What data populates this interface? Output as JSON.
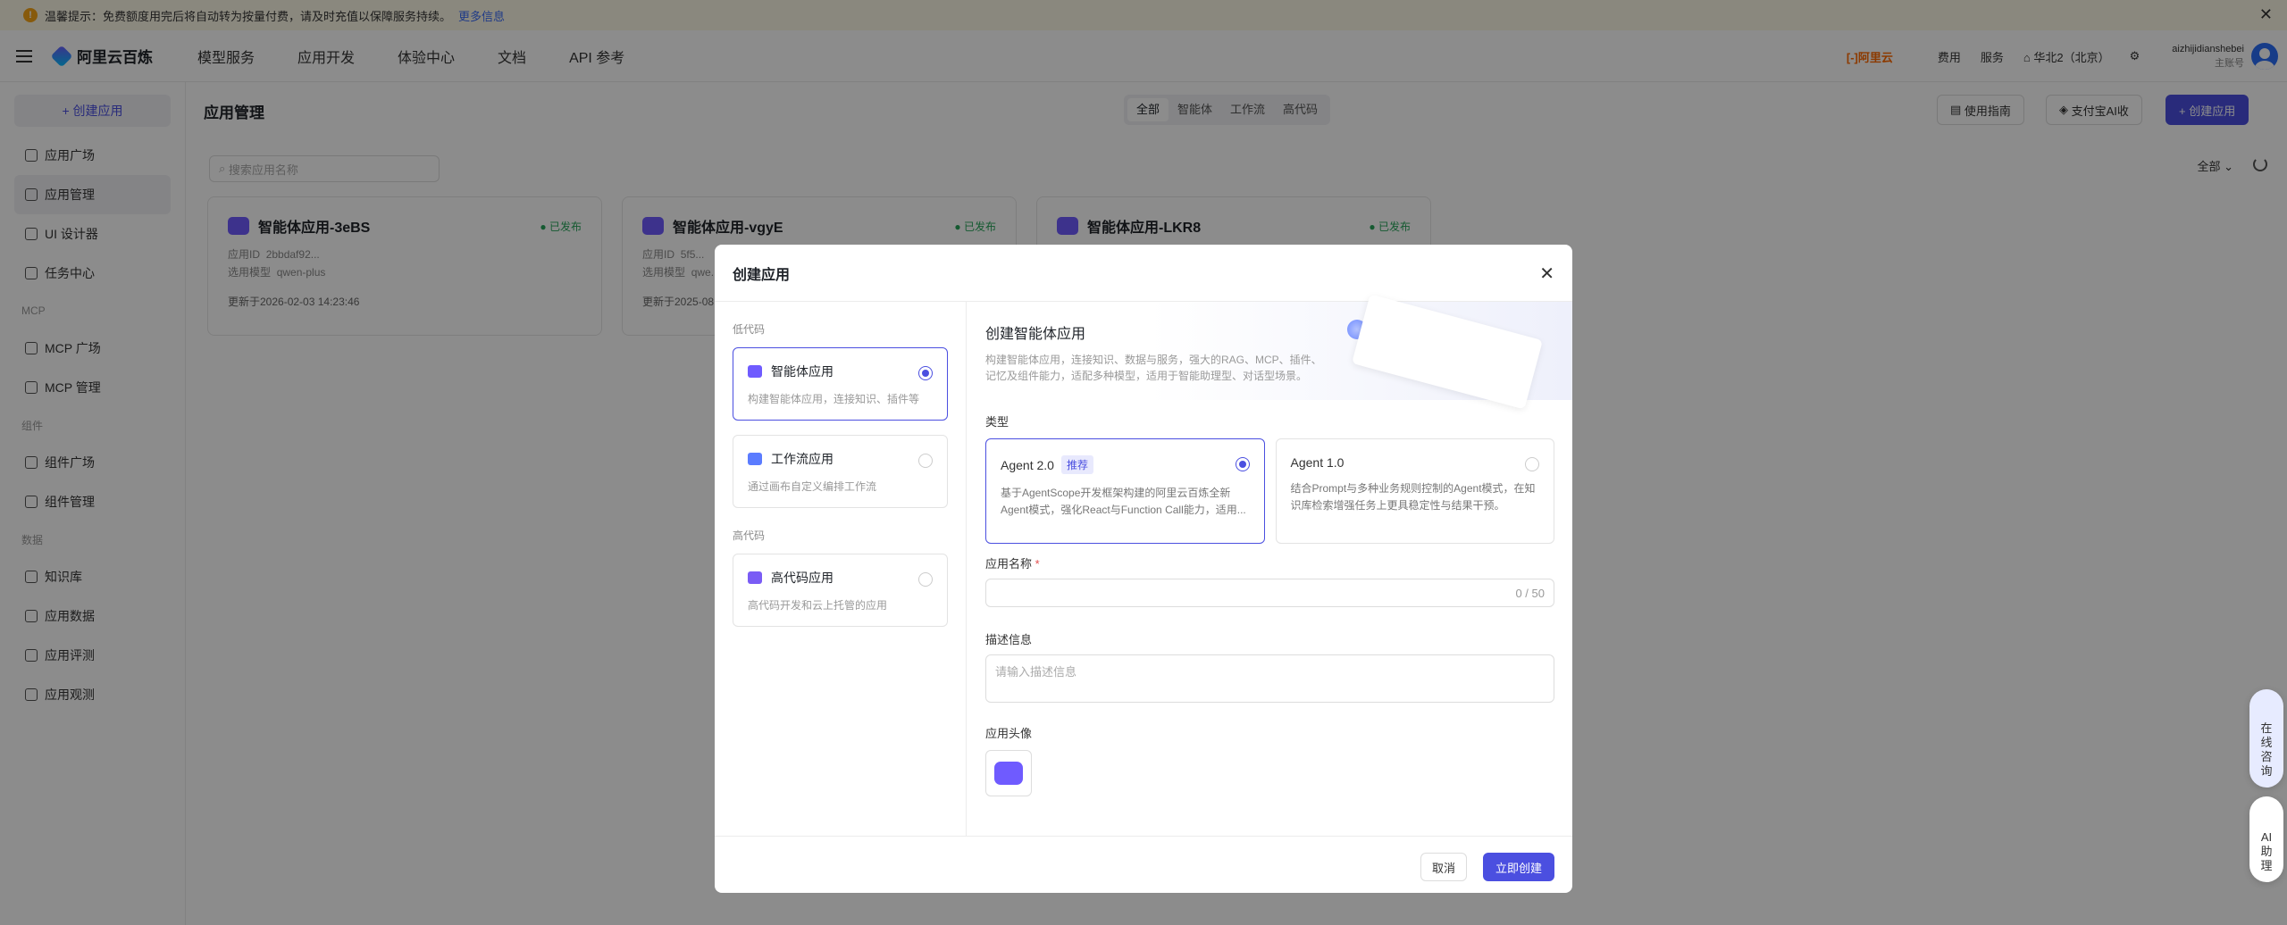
{
  "banner": {
    "text": "温馨提示：免费额度用完后将自动转为按量付费，请及时充值以保障服务持续。",
    "link": "更多信息"
  },
  "nav": {
    "brand": "阿里云百炼",
    "links": [
      "模型服务",
      "应用开发",
      "体验中心",
      "文档",
      "API 参考"
    ],
    "aliyun": "[-]阿里云",
    "fees": "费用",
    "service": "服务",
    "region": "华北2（北京）",
    "username": "aizhijidianshebei",
    "account_type": "主账号"
  },
  "sidebar": {
    "create": "+ 创建应用",
    "items": [
      "应用广场",
      "应用管理",
      "UI 设计器",
      "任务中心"
    ],
    "group_mcp": "MCP",
    "mcp_items": [
      "MCP 广场",
      "MCP 管理"
    ],
    "group_component": "组件",
    "component_items": [
      "组件广场",
      "组件管理"
    ],
    "group_data": "数据",
    "data_items": [
      "知识库",
      "应用数据",
      "应用评测",
      "应用观测"
    ]
  },
  "main": {
    "title": "应用管理",
    "segments": [
      "全部",
      "智能体",
      "工作流",
      "高代码"
    ],
    "guide": "使用指南",
    "alipay": "支付宝AI收",
    "create": "+ 创建应用",
    "search_placeholder": "搜索应用名称",
    "filter": "全部 ⌄",
    "cards": [
      {
        "name": "智能体应用-3eBS",
        "status": "● 已发布",
        "id_label": "应用ID",
        "id": "2bbdaf92...",
        "model_label": "选用模型",
        "model": "qwen-plus",
        "updated": "更新于2026-02-03 14:23:46"
      },
      {
        "name": "智能体应用-vgyE",
        "status": "● 已发布",
        "id_label": "应用ID",
        "id": "5f5...",
        "model_label": "选用模型",
        "model": "qwe...",
        "updated": "更新于2025-08..."
      },
      {
        "name": "智能体应用-LKR8",
        "status": "● 已发布"
      }
    ]
  },
  "modal": {
    "title": "创建应用",
    "group_low": "低代码",
    "options": [
      {
        "title": "智能体应用",
        "desc": "构建智能体应用，连接知识、插件等"
      },
      {
        "title": "工作流应用",
        "desc": "通过画布自定义编排工作流"
      }
    ],
    "group_high": "高代码",
    "high_option": {
      "title": "高代码应用",
      "desc": "高代码开发和云上托管的应用"
    },
    "hero_title": "创建智能体应用",
    "hero_desc": "构建智能体应用，连接知识、数据与服务，强大的RAG、MCP、插件、记忆及组件能力，适配多种模型，适用于智能助理型、对话型场景。",
    "type_label": "类型",
    "types": [
      {
        "title": "Agent 2.0",
        "badge": "推荐",
        "desc": "基于AgentScope开发框架构建的阿里云百炼全新Agent模式，强化React与Function Call能力，适用..."
      },
      {
        "title": "Agent 1.0",
        "desc": "结合Prompt与多种业务规则控制的Agent模式，在知识库检索增强任务上更具稳定性与结果干预。"
      }
    ],
    "name_label": "应用名称",
    "name_required": "*",
    "name_count": "0 / 50",
    "desc_label": "描述信息",
    "desc_placeholder": "请输入描述信息",
    "avatar_label": "应用头像",
    "cancel": "取消",
    "confirm": "立即创建"
  },
  "float": {
    "help": "在线咨询",
    "ai": "AI助理"
  }
}
